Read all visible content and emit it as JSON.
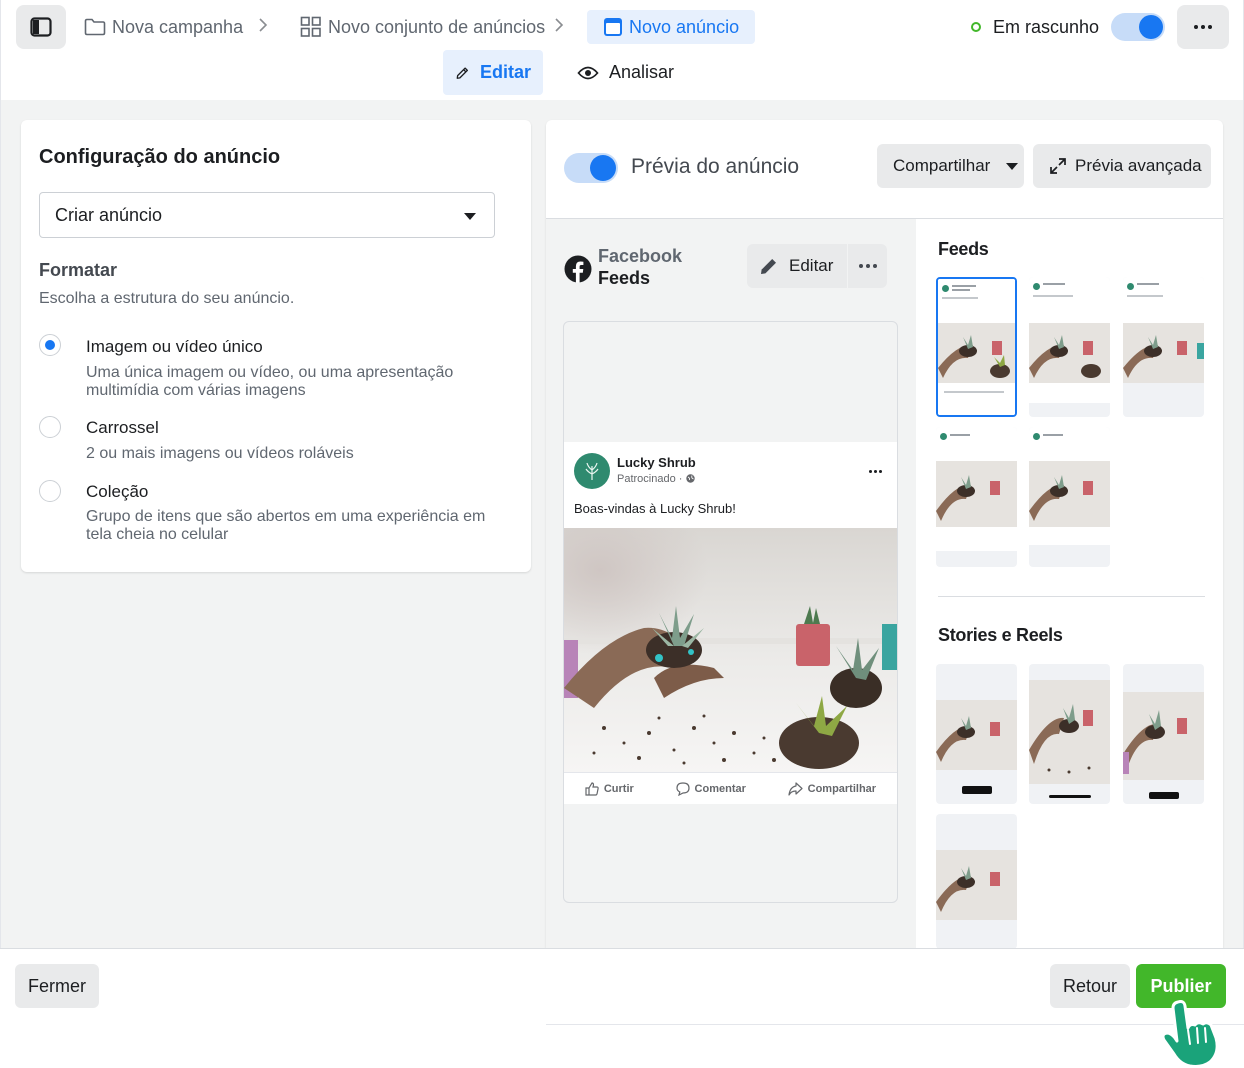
{
  "breadcrumb": {
    "campaign": "Nova campanha",
    "adset": "Novo conjunto de anúncios",
    "ad": "Novo anúncio"
  },
  "status": {
    "label": "Em rascunho",
    "toggle_on": true
  },
  "modes": {
    "edit": "Editar",
    "review": "Analisar"
  },
  "config": {
    "title": "Configuração do anúncio",
    "dropdown_value": "Criar anúncio",
    "format_title": "Formatar",
    "format_subtitle": "Escolha a estrutura do seu anúncio.",
    "options": [
      {
        "label": "Imagem ou vídeo único",
        "description": "Uma única imagem ou vídeo, ou uma apresentação multimídia com várias imagens",
        "selected": true
      },
      {
        "label": "Carrossel",
        "description": "2 ou mais imagens ou vídeos roláveis",
        "selected": false
      },
      {
        "label": "Coleção",
        "description": "Grupo de itens que são abertos em uma experiência em tela cheia no celular",
        "selected": false
      }
    ]
  },
  "preview": {
    "title": "Prévia do anúncio",
    "share_label": "Compartilhar",
    "advanced_label": "Prévia avançada",
    "placement_platform": "Facebook",
    "placement_name": "Feeds",
    "edit_label": "Editar",
    "post": {
      "page_name": "Lucky Shrub",
      "meta": "Patrocinado",
      "text": "Boas-vindas à Lucky Shrub!",
      "actions": [
        "Curtir",
        "Comentar",
        "Compartilhar"
      ]
    },
    "groups": {
      "feeds": "Feeds",
      "stories": "Stories e Reels"
    }
  },
  "footer": {
    "close": "Fermer",
    "back": "Retour",
    "publish": "Publier"
  },
  "colors": {
    "accent": "#1877f2",
    "publish": "#42b72a",
    "cursor": "#1aa37a"
  }
}
